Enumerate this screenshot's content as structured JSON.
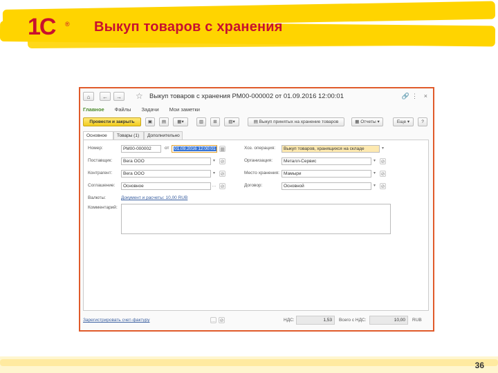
{
  "slide": {
    "logo": "1С",
    "logo_mark": "®",
    "title": "Выкуп товаров с хранения",
    "page_number": "36"
  },
  "window": {
    "title": "Выкуп товаров с хранения РМ00-000002 от 01.09.2016 12:00:01",
    "nav_tabs": [
      "Главное",
      "Файлы",
      "Задачи",
      "Мои заметки"
    ],
    "toolbar": {
      "post_and_close": "Провести и закрыть",
      "buyout_button": "Выкуп принятых на хранение товаров",
      "reports": "Отчеты",
      "more": "Еще",
      "help": "?"
    },
    "form_tabs": [
      "Основное",
      "Товары (1)",
      "Дополнительно"
    ],
    "fields": {
      "number_label": "Номер:",
      "number_value": "РМ00-000002",
      "from_label": "от",
      "date_value": "01.09.2016 12:00:01",
      "supplier_label": "Поставщик:",
      "supplier_value": "Вега ООО",
      "counterparty_label": "Контрагент:",
      "counterparty_value": "Вега ООО",
      "agreement_label": "Соглашение:",
      "agreement_value": "Основное",
      "currency_label": "Валюты:",
      "currency_link": "Документ и расчеты: 10,00 RUB",
      "comment_label": "Комментарий:",
      "operation_label": "Хоз. операция:",
      "operation_value": "Выкуп товаров, хранящихся на складе",
      "organization_label": "Организация:",
      "organization_value": "Металл-Сервис",
      "storage_label": "Место хранения:",
      "storage_value": "Мамыри",
      "contract_label": "Договор:",
      "contract_value": "Основной"
    },
    "footer": {
      "register_link": "Зарегистрировать счет-фактуру",
      "vat_label": "НДС:",
      "vat_value": "1,53",
      "total_label": "Всего с НДС:",
      "total_value": "10,00",
      "currency": "RUB"
    }
  },
  "colors": {
    "brand_red": "#c8102e",
    "highlight_yellow": "#ffd400",
    "window_border": "#e05a2a"
  }
}
